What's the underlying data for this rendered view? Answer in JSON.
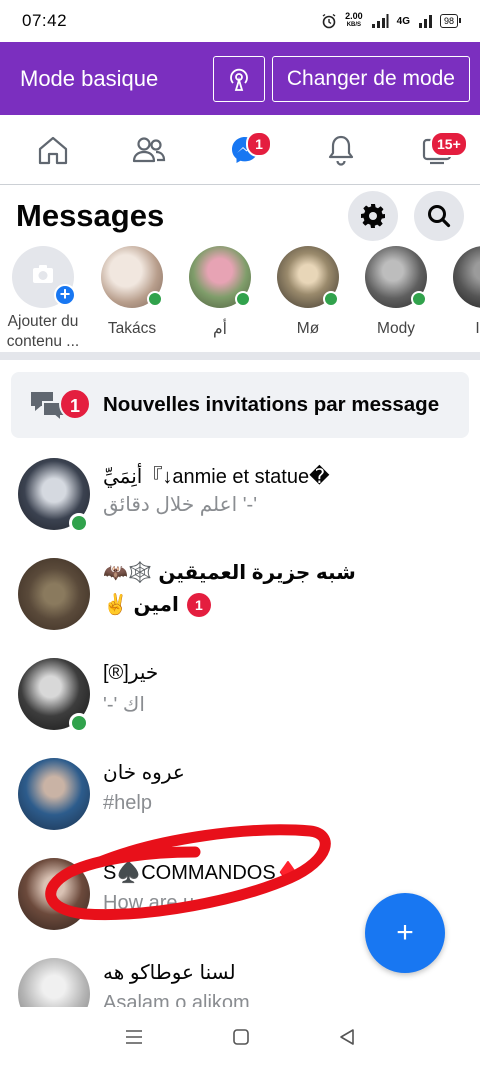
{
  "status_bar": {
    "time": "07:42",
    "net_speed_value": "2.00",
    "net_speed_unit": "KB/S",
    "network": "4G",
    "battery": "98"
  },
  "mode_bar": {
    "title": "Mode basique",
    "change_mode": "Changer de mode"
  },
  "nav": {
    "messenger_badge": "1",
    "video_badge": "15+"
  },
  "header": {
    "title": "Messages"
  },
  "stories": [
    {
      "label": "Ajouter du contenu ...",
      "type": "add"
    },
    {
      "label": "Takács",
      "color": "#c9b8a8"
    },
    {
      "label": "أم",
      "color": "#c77d8a"
    },
    {
      "label": "Mø",
      "color": "#5c554c"
    },
    {
      "label": "Mody",
      "color": "#6e6e6e"
    },
    {
      "label": "Im",
      "color": "#444"
    }
  ],
  "invitations": {
    "badge": "1",
    "label": "Nouvelles invitations par message"
  },
  "conversations": [
    {
      "name": "أنِمَيِّ『↓anmie et statue�",
      "snippet": "اعلم خلال دقائق '-'",
      "bold": false,
      "online": true,
      "color": "#3b4250"
    },
    {
      "name": "🦇🕸️ شبه جزيرة العميقين",
      "snippet": "✌️ امين",
      "bold": true,
      "unread": "1",
      "online": false,
      "color": "#5a4a3a"
    },
    {
      "name": "[®]خير",
      "snippet": "'-' اك",
      "bold": false,
      "online": true,
      "color": "#2a2a2a"
    },
    {
      "name": "عروه خان",
      "snippet": "#help",
      "bold": false,
      "online": false,
      "color": "#2d5c8c"
    },
    {
      "name": "S♠️COMMANDOS♦️",
      "snippet": "How are u",
      "bold": false,
      "online": false,
      "color": "#6c4a3c"
    },
    {
      "name": "لسنا عوطاكو هه",
      "snippet": "Asalam o alikom",
      "bold": false,
      "online": true,
      "color": "#c9c9c9"
    }
  ],
  "fab": {
    "label": "+"
  }
}
